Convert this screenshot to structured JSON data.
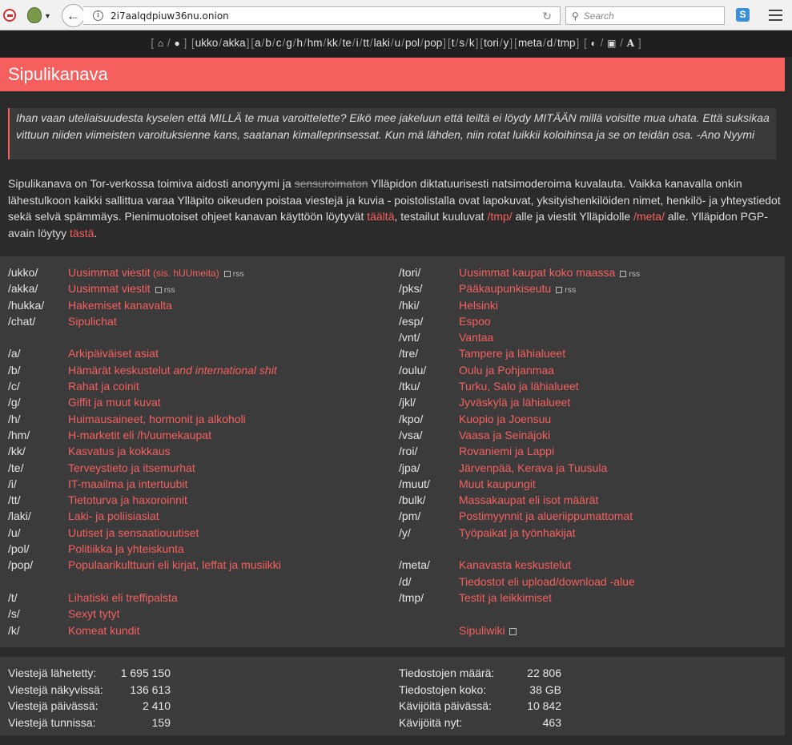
{
  "browser": {
    "url": "2i7aalqdpiuw36nu.onion",
    "search_placeholder": "Search",
    "search_badge": "S"
  },
  "nav": {
    "groups": [
      [
        "ukko",
        "akka"
      ],
      [
        "a",
        "b",
        "c",
        "g",
        "h",
        "hm",
        "kk",
        "te",
        "i",
        "tt",
        "laki",
        "u",
        "pol",
        "pop"
      ],
      [
        "t",
        "s",
        "k"
      ],
      [
        "tori",
        "y"
      ],
      [
        "meta",
        "d",
        "tmp"
      ]
    ]
  },
  "site_title": "Sipulikanava",
  "quote": "Ihan vaan uteliaisuudesta kyselen että MILLÄ te mua varoittelette? Eikö mee jakeluun että teiltä ei löydy MITÄÄN millä voisitte mua uhata. Että suksikaa vittuun niiden viimeisten varoituksienne kans, saatanan kimalleprinsessat. Kun mä lähden, niin rotat luikkii koloihinsa ja se on teidän osa. -Ano Nyymi",
  "intro": {
    "p1": "Sipulikanava on Tor-verkossa toimiva aidosti anonyymi ja ",
    "strike": "sensuroimaton",
    "p2": " Ylläpidon diktatuurisesti natsimoderoima kuvalauta. Vaikka kanavalla onkin lähestulkoon kaikki sallittua varaa Ylläpito oikeuden poistaa viestejä ja kuvia - poistolistalla ovat lapokuvat, yksityishenkilöiden nimet, henkilö- ja yhteystiedot sekä selvä spämmäys. Pienimuotoiset ohjeet kanavan käyttöön löytyvät ",
    "link1": "täältä",
    "p3": ", testailut kuuluvat ",
    "link2": "/tmp/",
    "p4": " alle ja viestit Ylläpidolle ",
    "link3": "/meta/",
    "p5": " alle. Ylläpidon PGP-avain löytyy ",
    "link4": "tästä",
    "p6": "."
  },
  "boards_left": [
    {
      "code": "/ukko/",
      "name": "Uusimmat viestit",
      "sub": " (sis. hUUmeita)",
      "rss": "rss"
    },
    {
      "code": "/akka/",
      "name": "Uusimmat viestit",
      "rss": "rss"
    },
    {
      "code": "/hukka/",
      "name": "Hakemiset kanavalta"
    },
    {
      "code": "/chat/",
      "name": "Sipulichat"
    },
    {
      "gap": true
    },
    {
      "code": "/a/",
      "name": "Arkipäiväiset asiat"
    },
    {
      "code": "/b/",
      "name": "Hämärät keskustelut ",
      "em": "and international shit"
    },
    {
      "code": "/c/",
      "name": "Rahat ja coinit"
    },
    {
      "code": "/g/",
      "name": "Giffit ja muut kuvat"
    },
    {
      "code": "/h/",
      "name": "Huimausaineet, hormonit ja alkoholi"
    },
    {
      "code": "/hm/",
      "name": "H-marketit eli /h/uumekaupat"
    },
    {
      "code": "/kk/",
      "name": "Kasvatus ja kokkaus"
    },
    {
      "code": "/te/",
      "name": "Terveystieto ja itsemurhat"
    },
    {
      "code": "/i/",
      "name": "IT-maailma ja intertuubit"
    },
    {
      "code": "/tt/",
      "name": "Tietoturva ja haxoroinnit"
    },
    {
      "code": "/laki/",
      "name": "Laki- ja poliisiasiat"
    },
    {
      "code": "/u/",
      "name": "Uutiset ja sensaatiouutiset"
    },
    {
      "code": "/pol/",
      "name": "Politiikka ja yhteiskunta"
    },
    {
      "code": "/pop/",
      "name": "Populaarikulttuuri eli kirjat, leffat ja musiikki"
    },
    {
      "gap": true
    },
    {
      "code": "/t/",
      "name": "Lihatiski eli treffipalsta"
    },
    {
      "code": "/s/",
      "name": "Sexyt tytyt"
    },
    {
      "code": "/k/",
      "name": "Komeat kundit"
    }
  ],
  "boards_right": [
    {
      "code": "/tori/",
      "name": "Uusimmat kaupat koko maassa",
      "rss": "rss"
    },
    {
      "code": "/pks/",
      "name": "Pääkaupunkiseutu",
      "rss": "rss"
    },
    {
      "code": "/hki/",
      "name": "Helsinki"
    },
    {
      "code": "/esp/",
      "name": "Espoo"
    },
    {
      "code": "/vnt/",
      "name": "Vantaa"
    },
    {
      "code": "/tre/",
      "name": "Tampere ja lähialueet"
    },
    {
      "code": "/oulu/",
      "name": "Oulu ja Pohjanmaa"
    },
    {
      "code": "/tku/",
      "name": "Turku, Salo ja lähialueet"
    },
    {
      "code": "/jkl/",
      "name": "Jyväskylä ja lähialueet"
    },
    {
      "code": "/kpo/",
      "name": "Kuopio ja Joensuu"
    },
    {
      "code": "/vsa/",
      "name": "Vaasa ja Seinäjoki"
    },
    {
      "code": "/roi/",
      "name": "Rovaniemi ja Lappi"
    },
    {
      "code": "/jpa/",
      "name": "Järvenpää, Kerava ja Tuusula"
    },
    {
      "code": "/muut/",
      "name": "Muut kaupungit"
    },
    {
      "code": "/bulk/",
      "name": "Massakaupat eli isot määrät"
    },
    {
      "code": "/pm/",
      "name": "Postimyynnit ja alueriippumattomat"
    },
    {
      "code": "/y/",
      "name": "Työpaikat ja työnhakijat"
    },
    {
      "gap": true
    },
    {
      "code": "/meta/",
      "name": "Kanavasta keskustelut"
    },
    {
      "code": "/d/",
      "name": "Tiedostot eli upload/download -alue"
    },
    {
      "code": "/tmp/",
      "name": "Testit ja leikkimiset"
    },
    {
      "gap": true
    },
    {
      "code": "",
      "name": "Sipuliwiki",
      "ext": true
    }
  ],
  "stats_left": [
    {
      "label": "Viestejä lähetetty:",
      "value": "1 695 150"
    },
    {
      "label": "Viestejä näkyvissä:",
      "value": "136 613"
    },
    {
      "label": "Viestejä päivässä:",
      "value": "2 410"
    },
    {
      "label": "Viestejä tunnissa:",
      "value": "159"
    }
  ],
  "stats_right": [
    {
      "label": "Tiedostojen määrä:",
      "value": "22 806"
    },
    {
      "label": "Tiedostojen koko:",
      "value": "38 GB"
    },
    {
      "label": "Kävijöitä päivässä:",
      "value": "10 842"
    },
    {
      "label": "Kävijöitä nyt:",
      "value": "463"
    }
  ]
}
